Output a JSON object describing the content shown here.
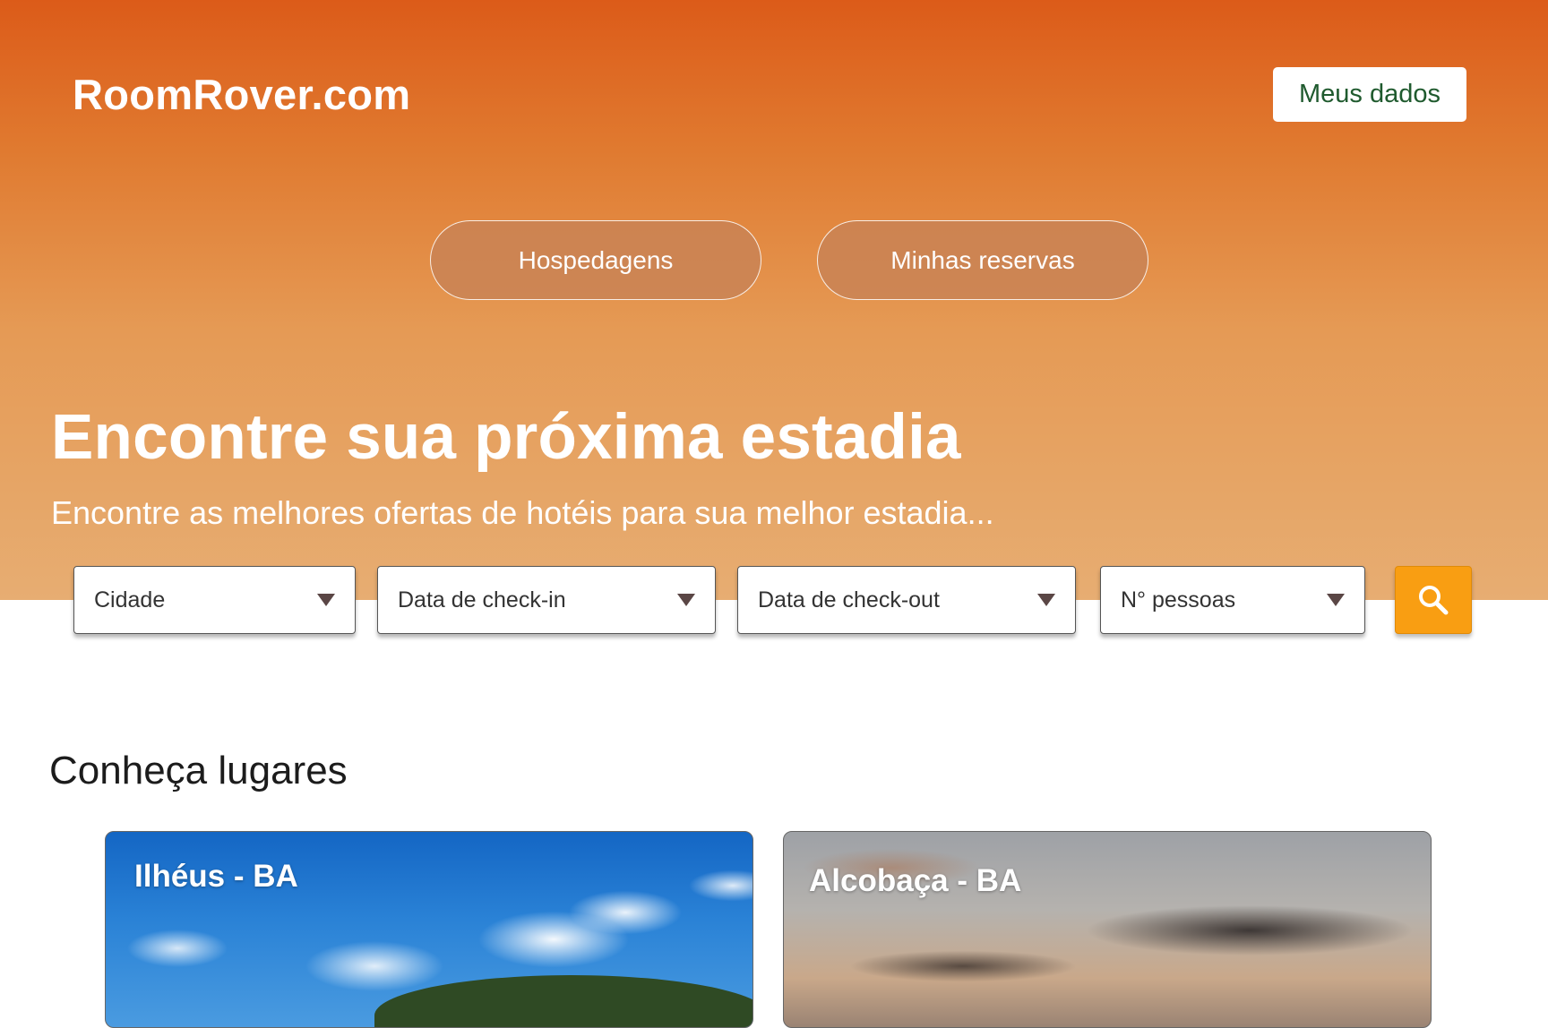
{
  "header": {
    "logo": "RoomRover.com",
    "account_button": "Meus dados"
  },
  "nav": {
    "tabs": [
      {
        "label": "Hospedagens"
      },
      {
        "label": "Minhas reservas"
      }
    ]
  },
  "hero": {
    "title": "Encontre sua próxima estadia",
    "subtitle": "Encontre as melhores ofertas de hotéis para sua melhor estadia..."
  },
  "search": {
    "fields": [
      {
        "label": "Cidade"
      },
      {
        "label": "Data de check-in"
      },
      {
        "label": "Data de check-out"
      },
      {
        "label": "N° pessoas"
      }
    ],
    "button_icon": "search-icon"
  },
  "places": {
    "title": "Conheça lugares",
    "cards": [
      {
        "label": "Ilhéus - BA"
      },
      {
        "label": "Alcobaça - BA"
      }
    ]
  },
  "colors": {
    "hero_top": "#dc5b19",
    "hero_bottom": "#e7ad72",
    "search_button": "#f99e12",
    "account_text": "#1f5a2e"
  }
}
